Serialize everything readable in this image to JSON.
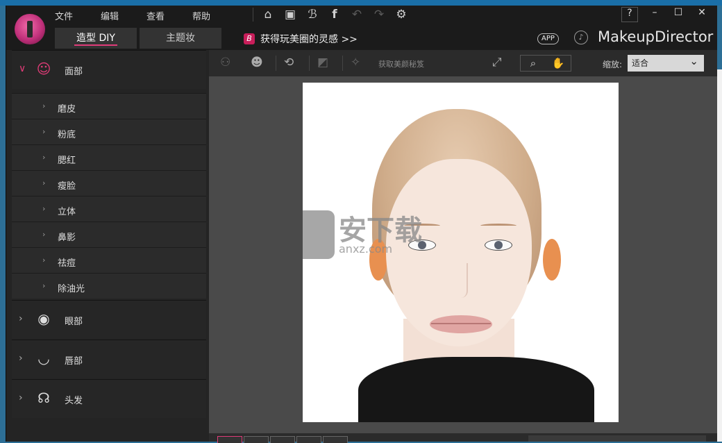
{
  "menu": [
    "文件",
    "编辑",
    "查看",
    "帮助"
  ],
  "tabs": [
    {
      "label": "造型 DIY"
    },
    {
      "label": "主题妆"
    }
  ],
  "promo": {
    "icon_text": "B",
    "text": "获得玩美圈的灵感 >>"
  },
  "header": {
    "app_badge": "APP",
    "brand": "MakeupDirector",
    "help": "?"
  },
  "toolbar": {
    "get_secret": "获取美颜秘笈",
    "zoom_label": "缩放:",
    "zoom_value": "适合"
  },
  "sidebar": {
    "face": {
      "label": "面部",
      "items": [
        "磨皮",
        "粉底",
        "腮红",
        "瘦脸",
        "立体",
        "鼻影",
        "祛痘",
        "除油光"
      ]
    },
    "eyes": {
      "label": "眼部"
    },
    "lips": {
      "label": "唇部"
    },
    "hair": {
      "label": "头发"
    }
  },
  "watermark": {
    "big": "安下载",
    "small": "anxz.com"
  },
  "icons": {
    "home": "home-icon",
    "save": "save-icon",
    "b": "b-icon",
    "facebook": "facebook-icon",
    "undo": "undo-icon",
    "redo": "redo-icon",
    "settings": "gear-icon"
  },
  "colors": {
    "accent": "#e03c7a"
  }
}
